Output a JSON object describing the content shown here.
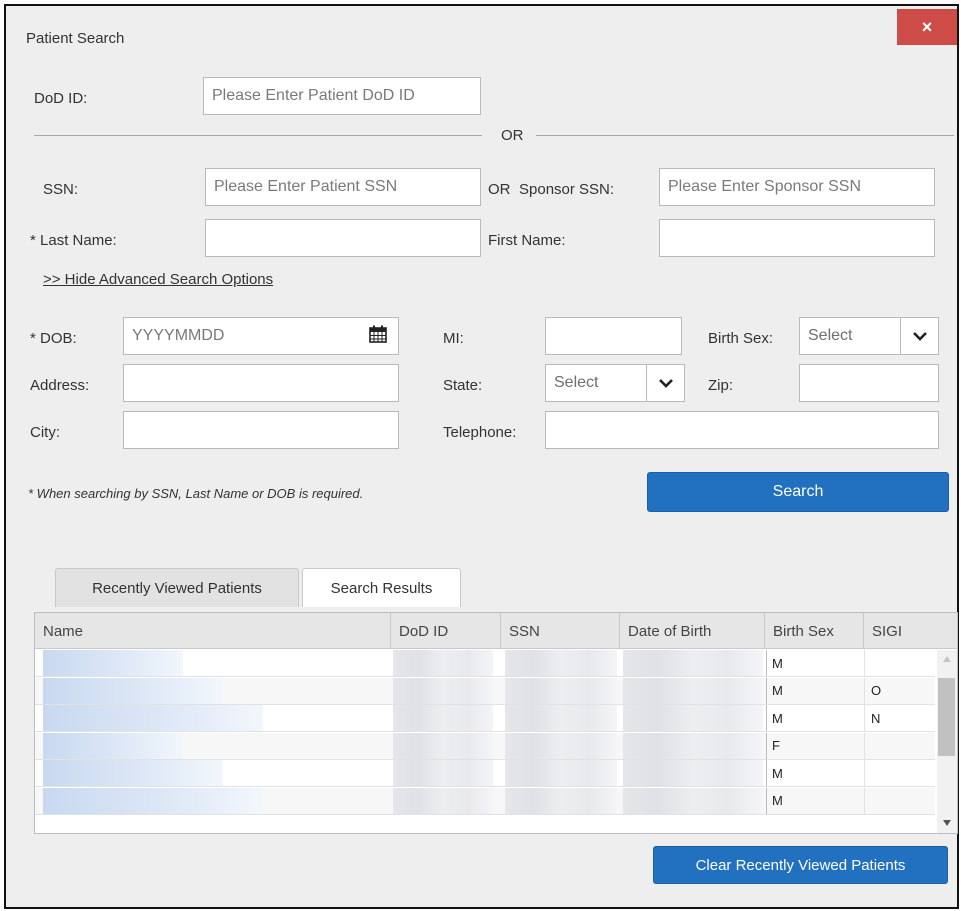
{
  "dialog": {
    "title": "Patient Search",
    "close_label": "×"
  },
  "dod_id": {
    "label": "DoD ID:",
    "placeholder": "Please Enter Patient DoD ID",
    "value": ""
  },
  "or_divider": "OR",
  "ssn": {
    "label": "SSN:",
    "placeholder": "Please Enter Patient SSN",
    "value": ""
  },
  "or_inline": "OR",
  "sponsor_ssn": {
    "label": "Sponsor SSN:",
    "placeholder": "Please Enter Sponsor SSN",
    "value": ""
  },
  "last_name": {
    "label": "* Last Name:",
    "value": ""
  },
  "first_name": {
    "label": "First Name:",
    "value": ""
  },
  "advanced_toggle": ">> Hide Advanced Search Options",
  "dob": {
    "label": "* DOB:",
    "placeholder": "YYYYMMDD",
    "value": "",
    "icon": "calendar-icon"
  },
  "mi": {
    "label": "MI:",
    "value": ""
  },
  "birth_sex": {
    "label": "Birth Sex:",
    "selected": "Select"
  },
  "address": {
    "label": "Address:",
    "value": ""
  },
  "state": {
    "label": "State:",
    "selected": "Select"
  },
  "zip": {
    "label": "Zip:",
    "value": ""
  },
  "city": {
    "label": "City:",
    "value": ""
  },
  "telephone": {
    "label": "Telephone:",
    "value": ""
  },
  "search_note": "* When searching by SSN, Last Name or DOB is required.",
  "search_button": "Search",
  "tabs": [
    {
      "label": "Recently Viewed Patients",
      "active": true
    },
    {
      "label": "Search Results",
      "active": false
    }
  ],
  "grid": {
    "columns": [
      "Name",
      "DoD ID",
      "SSN",
      "Date of Birth",
      "Birth Sex",
      "SIGI"
    ],
    "rows": [
      {
        "birth_sex": "M",
        "sigi": ""
      },
      {
        "birth_sex": "M",
        "sigi": "O"
      },
      {
        "birth_sex": "M",
        "sigi": "N"
      },
      {
        "birth_sex": "F",
        "sigi": ""
      },
      {
        "birth_sex": "M",
        "sigi": ""
      },
      {
        "birth_sex": "M",
        "sigi": ""
      }
    ]
  },
  "clear_button": "Clear Recently Viewed Patients",
  "colors": {
    "accent": "#2270c0",
    "close": "#cd4c47",
    "dialog_bg": "#eeeeee"
  }
}
